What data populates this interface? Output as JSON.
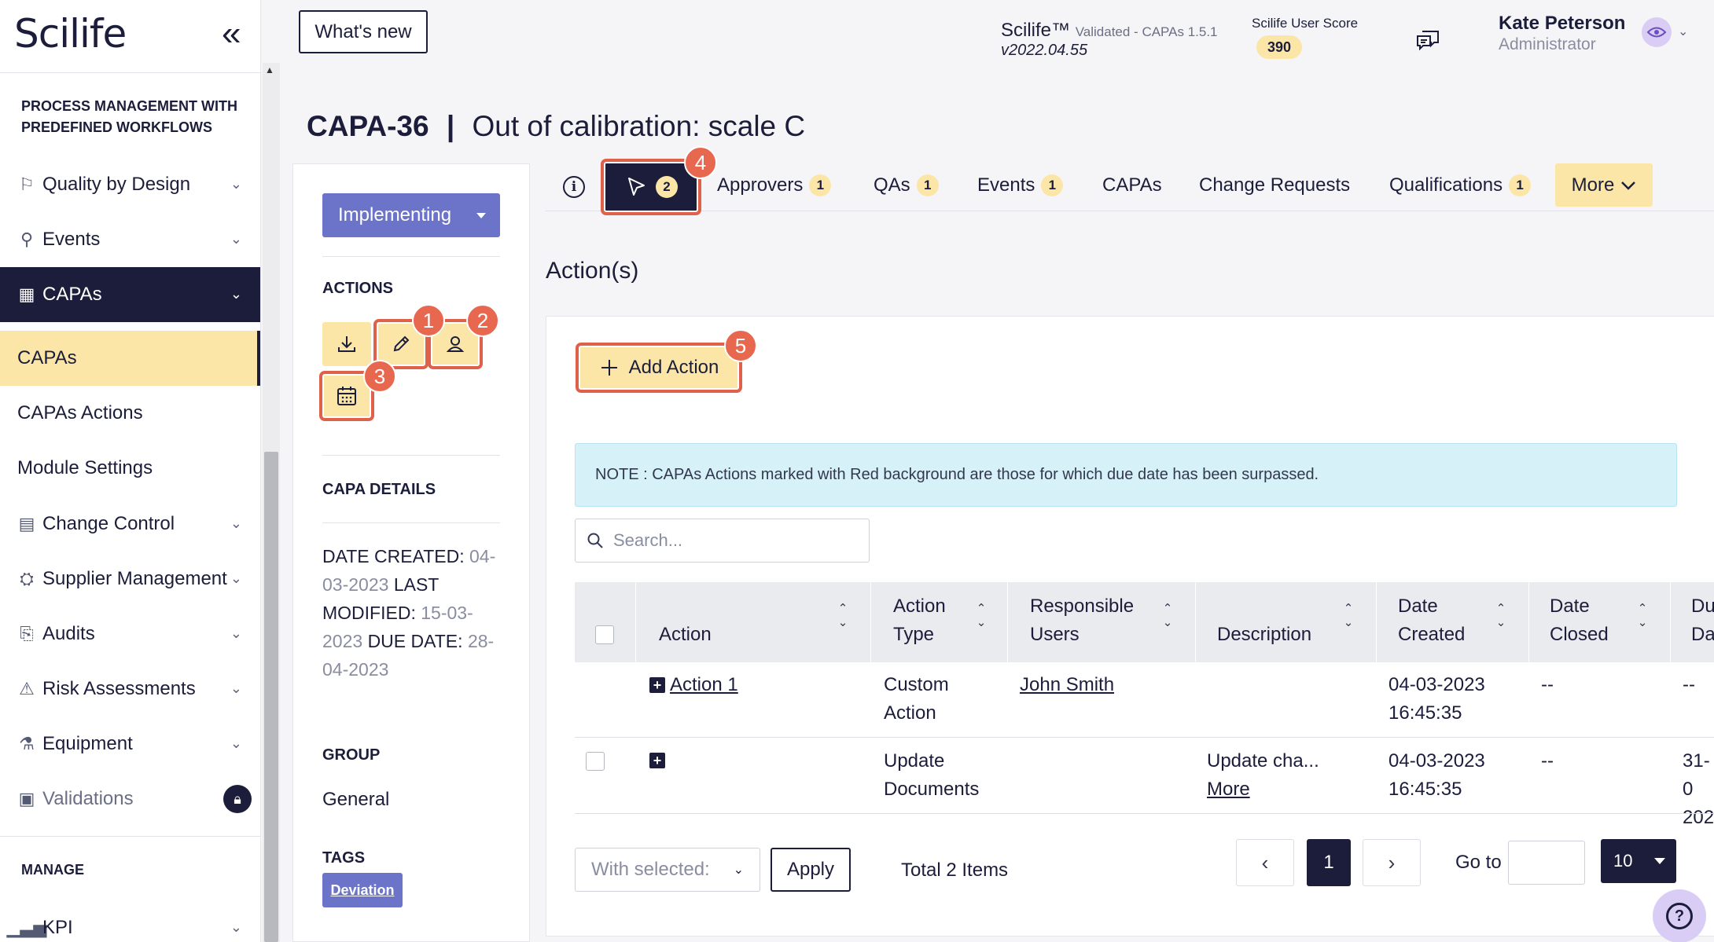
{
  "app": {
    "logo": "Scilife",
    "whats_new": "What's new",
    "product": "Scilife™",
    "product_sub": "Validated - CAPAs 1.5.1",
    "version": "v2022.04.55",
    "score_label": "Scilife User Score",
    "score_value": "390",
    "user_name": "Kate Peterson",
    "user_role": "Administrator"
  },
  "sidebar": {
    "section_title": "PROCESS MANAGEMENT WITH PREDEFINED WORKFLOWS",
    "items": [
      {
        "label": "Quality by Design",
        "icon": "blueprint-icon"
      },
      {
        "label": "Events",
        "icon": "pin-icon"
      },
      {
        "label": "CAPAs",
        "icon": "factory-icon"
      },
      {
        "label": "Change Control",
        "icon": "document-icon"
      },
      {
        "label": "Supplier Management",
        "icon": "supplier-icon"
      },
      {
        "label": "Audits",
        "icon": "audit-icon"
      },
      {
        "label": "Risk Assessments",
        "icon": "warning-icon"
      },
      {
        "label": "Equipment",
        "icon": "flask-icon"
      },
      {
        "label": "Validations",
        "icon": "clipboard-icon"
      }
    ],
    "subitems": [
      {
        "label": "CAPAs"
      },
      {
        "label": "CAPAs Actions"
      },
      {
        "label": "Module Settings"
      }
    ],
    "manage_title": "MANAGE",
    "kpi_label": "KPI"
  },
  "record": {
    "id": "CAPA-36",
    "separator": "|",
    "title": "Out of calibration: scale C",
    "status": "Implementing",
    "actions_heading": "ACTIONS",
    "details_heading": "CAPA DETAILS",
    "date_created_label": "DATE CREATED:",
    "date_created": "04-03-2023",
    "last_modified_label": "LAST MODIFIED:",
    "last_modified": "15-03-2023",
    "due_date_label": "DUE DATE:",
    "due_date": "28-04-2023",
    "group_heading": "GROUP",
    "group": "General",
    "tags_heading": "TAGS",
    "tag": "Deviation"
  },
  "callouts": [
    "1",
    "2",
    "3",
    "4",
    "5"
  ],
  "tabs": {
    "actions_count": "2",
    "items": [
      {
        "label": "Approvers",
        "count": "1"
      },
      {
        "label": "QAs",
        "count": "1"
      },
      {
        "label": "Events",
        "count": "1"
      },
      {
        "label": "CAPAs",
        "count": ""
      },
      {
        "label": "Change Requests",
        "count": ""
      },
      {
        "label": "Qualifications",
        "count": "1"
      }
    ],
    "more": "More"
  },
  "main": {
    "heading": "Action(s)",
    "add_action": "Add Action",
    "note": "NOTE : CAPAs Actions marked with Red background are those for which due date has been surpassed.",
    "search_placeholder": "Search..."
  },
  "table": {
    "headers": {
      "action": "Action",
      "action_type_1": "Action",
      "action_type_2": "Type",
      "responsible_1": "Responsible",
      "responsible_2": "Users",
      "description": "Description",
      "date_created_1": "Date",
      "date_created_2": "Created",
      "date_closed_1": "Date",
      "date_closed_2": "Closed",
      "due_1": "Du",
      "due_2": "Da"
    },
    "rows": [
      {
        "action": "Action 1",
        "type_1": "Custom",
        "type_2": "Action",
        "user": "John Smith",
        "description": "",
        "more": "",
        "created_1": "04-03-2023",
        "created_2": "16:45:35",
        "closed": "--",
        "due_1": "--",
        "due_2": ""
      },
      {
        "action": "",
        "type_1": "Update",
        "type_2": "Documents",
        "user": "",
        "description": "Update cha...",
        "more": "More",
        "created_1": "04-03-2023",
        "created_2": "16:45:35",
        "closed": "--",
        "due_1": "31-0",
        "due_2": "202"
      }
    ]
  },
  "footer": {
    "with_selected": "With selected:",
    "apply": "Apply",
    "total": "Total 2 Items",
    "prev": "‹",
    "current_page": "1",
    "next": "›",
    "goto": "Go to",
    "page_size": "10",
    "help": "?"
  }
}
